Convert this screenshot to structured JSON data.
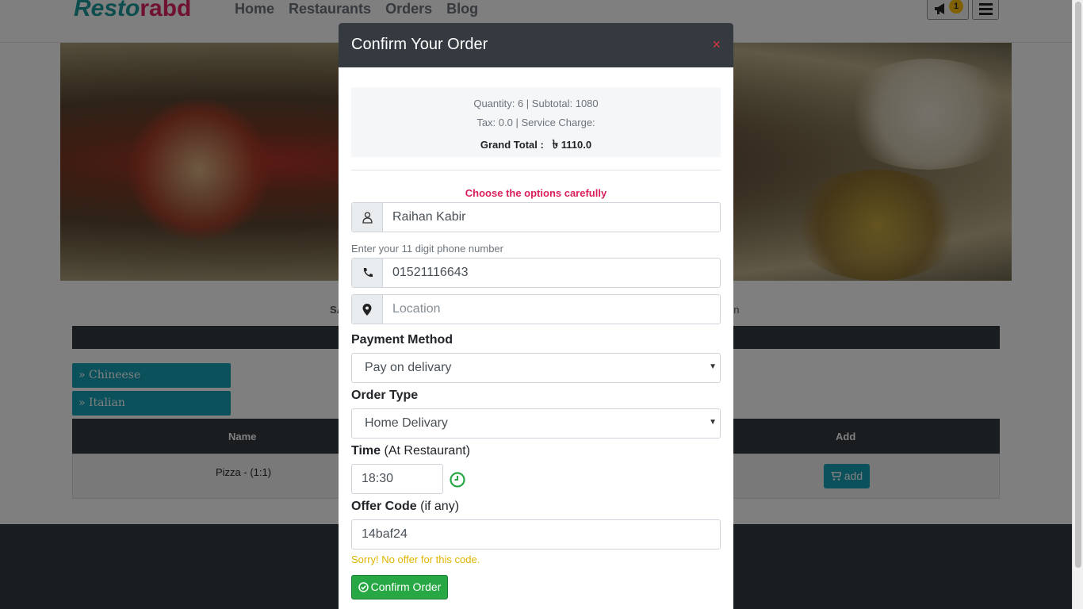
{
  "nav": {
    "logo_part1": "Resto",
    "logo_part2": "rabd",
    "links": [
      "Home",
      "Restaurants",
      "Orders",
      "Blog"
    ],
    "notification_count": "1"
  },
  "page": {
    "info_left": "SA",
    "info_right": "en",
    "categories": [
      "» Chineese",
      "» Italian"
    ],
    "table_headers": {
      "name": "Name",
      "add": "Add"
    },
    "rows": [
      {
        "name": "Pizza - (1:1)",
        "add_label": "add"
      }
    ]
  },
  "modal": {
    "title": "Confirm Your Order",
    "close": "×",
    "summary": {
      "line1": "Quantity: 6 | Subtotal: 1080",
      "line2": "Tax: 0.0 | Service Charge:",
      "grand_label": "Grand Total :",
      "currency": "৳",
      "grand_value": "1110.0"
    },
    "warning": "Choose the options carefully",
    "name_value": "Raihan Kabir",
    "phone_hint": "Enter your 11 digit phone number",
    "phone_value": "01521116643",
    "location_placeholder": "Location",
    "payment_label": "Payment Method",
    "payment_value": "Pay on delivary",
    "order_type_label": "Order Type",
    "order_type_value": "Home Delivary",
    "time_label": "Time",
    "time_note": "(At Restaurant)",
    "time_value": "18:30",
    "offer_label": "Offer Code",
    "offer_note": "(if any)",
    "offer_value": "14baf24",
    "offer_error": "Sorry! No offer for this code.",
    "confirm_label": "Confirm Order"
  },
  "colors": {
    "header_dark": "#343a40",
    "warning_pink": "#dc1e5a",
    "success_green": "#28a745",
    "info_teal": "#17a2b8",
    "offer_error_yellow": "#e0b400"
  }
}
